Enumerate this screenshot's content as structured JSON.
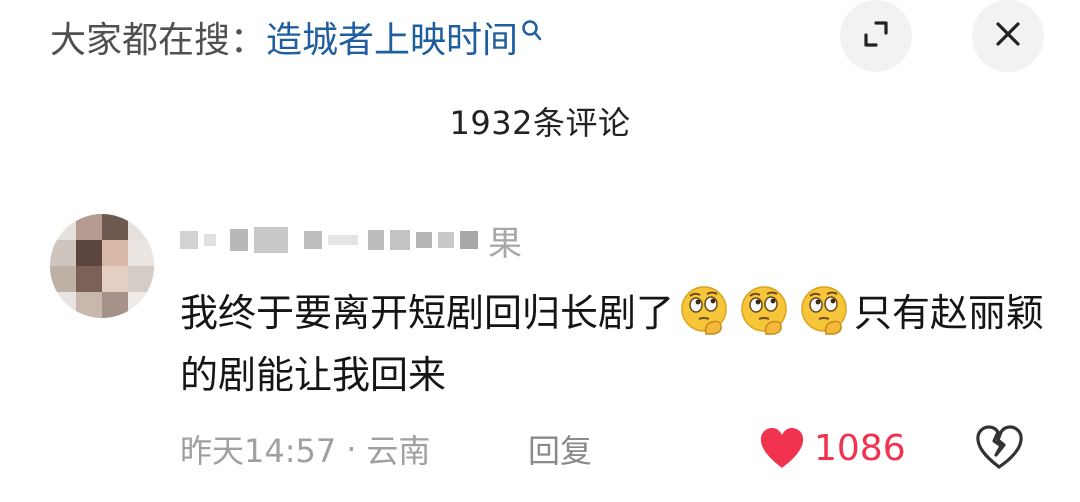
{
  "header": {
    "search_prefix": "大家都在搜：",
    "search_term": "造城者上映时间",
    "icons": [
      "search-icon",
      "expand-icon",
      "close-icon"
    ]
  },
  "comments_title": "1932条评论",
  "comment": {
    "username_visible_tail": "果",
    "text": "我终于要离开短剧回归长剧了",
    "emoji_count": 3,
    "text_after_emoji": "只有赵丽颖的剧能让我回来",
    "time": "昨天14:57",
    "separator": "·",
    "location": "云南",
    "reply_label": "回复",
    "likes": "1086",
    "like_color": "#f0324f"
  }
}
